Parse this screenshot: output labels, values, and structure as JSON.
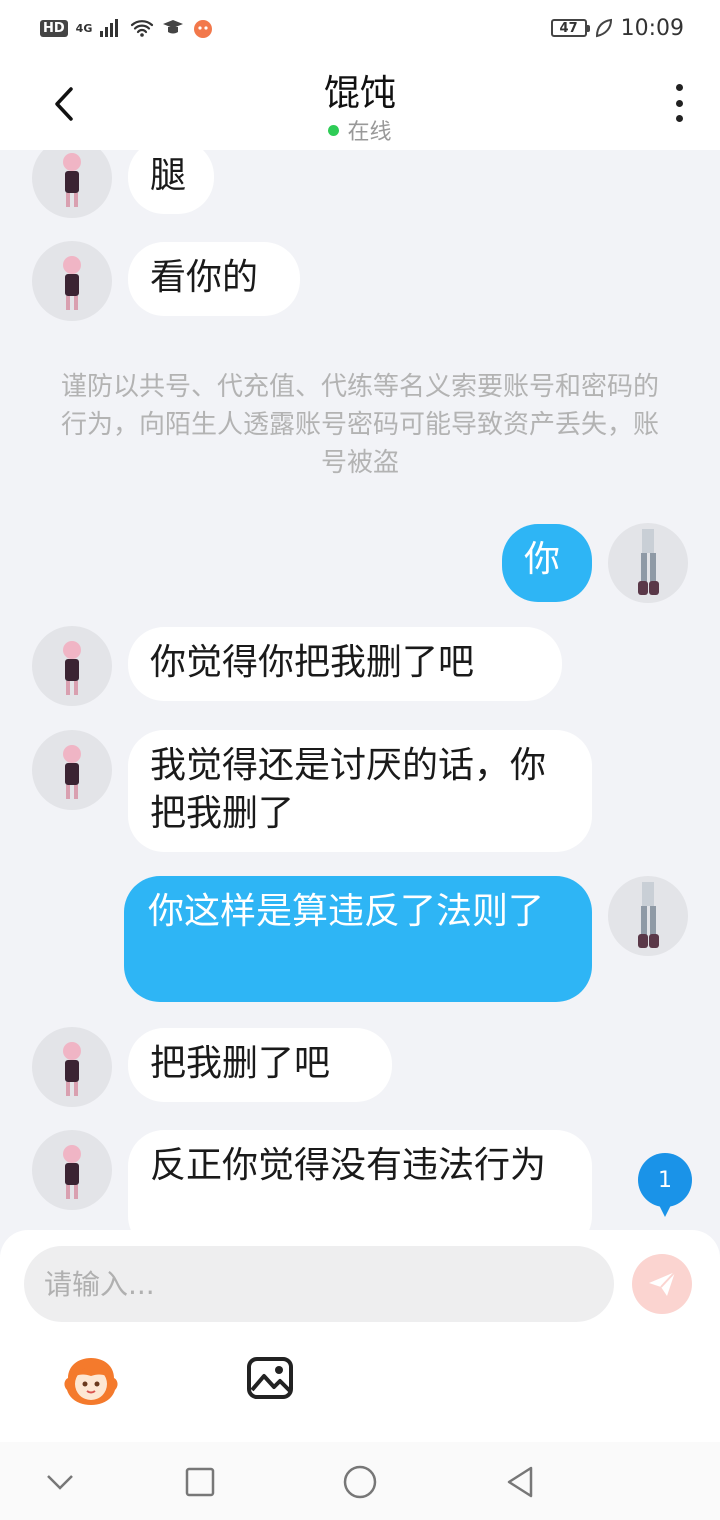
{
  "status_bar": {
    "hd": "HD",
    "network": "4G",
    "battery": "47",
    "time": "10:09"
  },
  "header": {
    "title": "馄饨",
    "status": "在线"
  },
  "messages": [
    {
      "side": "in",
      "text": "腿"
    },
    {
      "side": "in",
      "text": "看你的"
    },
    {
      "side": "in",
      "text": "你觉得你把我删了吧"
    },
    {
      "side": "in",
      "text": "我觉得还是讨厌的话，你把我删了"
    },
    {
      "side": "out",
      "text": "你"
    },
    {
      "side": "out",
      "text": "你这样是算违反了法则了"
    },
    {
      "side": "in",
      "text": "把我删了吧"
    },
    {
      "side": "in",
      "text": "反正你觉得没有违法行为"
    }
  ],
  "notice": "谨防以共号、代充值、代练等名义索要账号和密码的行为，向陌生人透露账号密码可能导致资产丢失，账号被盗",
  "unread_badge": "1",
  "input": {
    "placeholder": "请输入..."
  },
  "colors": {
    "outgoing_bubble": "#2eb5f5",
    "online_dot": "#2ecc56",
    "badge": "#1a93e8",
    "send_button": "#fbd4d0"
  },
  "icons": [
    "back-arrow-icon",
    "more-vertical-icon",
    "send-icon",
    "emoji-sticker-icon",
    "image-icon",
    "nav-back-icon",
    "nav-home-icon",
    "nav-recents-icon",
    "nav-collapse-icon"
  ]
}
